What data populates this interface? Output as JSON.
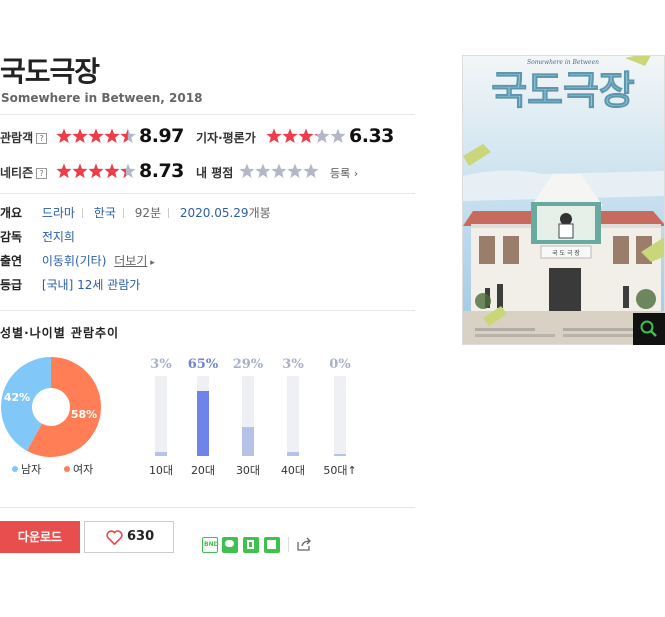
{
  "movie": {
    "title": "국도극장",
    "subtitle": "Somewhere in Between, 2018"
  },
  "ratings": {
    "audience": {
      "label": "관람객",
      "help": "?",
      "score": "8.97",
      "stars": 4.49
    },
    "critics": {
      "label": "기자·평론가",
      "score": "6.33",
      "stars": 3.17
    },
    "netizen": {
      "label": "네티즌",
      "help": "?",
      "score": "8.73",
      "stars": 4.37
    },
    "mine": {
      "label": "내 평점",
      "register": "등록",
      "stars": 0
    },
    "colors": {
      "star_on": "#ef3c4a",
      "star_off": "#b4b8c6"
    }
  },
  "info": {
    "overview": {
      "key": "개요",
      "genre": "드라마",
      "country": "한국",
      "runtime": "92분",
      "release_date": "2020.05.29",
      "release_suffix": "개봉"
    },
    "director": {
      "key": "감독",
      "value": "전지희"
    },
    "cast": {
      "key": "출연",
      "value": "이동휘(기타)",
      "more": "더보기"
    },
    "rating": {
      "key": "등급",
      "value": "[국내] 12세 관람가"
    }
  },
  "trend": {
    "title": "성별·나이별 관람추이",
    "gender": {
      "male_pct": 42,
      "female_pct": 58,
      "male_label": "42%",
      "female_label": "58%",
      "male_name": "남자",
      "female_name": "여자",
      "male_color": "#81c8f8",
      "female_color": "#ff7e56"
    },
    "ages": [
      {
        "label": "10대",
        "pct": 3,
        "pct_label": "3%"
      },
      {
        "label": "20대",
        "pct": 65,
        "pct_label": "65%"
      },
      {
        "label": "30대",
        "pct": 29,
        "pct_label": "29%"
      },
      {
        "label": "40대",
        "pct": 3,
        "pct_label": "3%"
      },
      {
        "label": "50대",
        "pct": 0,
        "pct_label": "0%"
      }
    ]
  },
  "actions": {
    "download": "다운로드",
    "likes": "630"
  },
  "poster": {
    "title_art": "국도극장",
    "subtitle_art": "Somewhere in Between",
    "building_sign": "국 도 극 장"
  }
}
